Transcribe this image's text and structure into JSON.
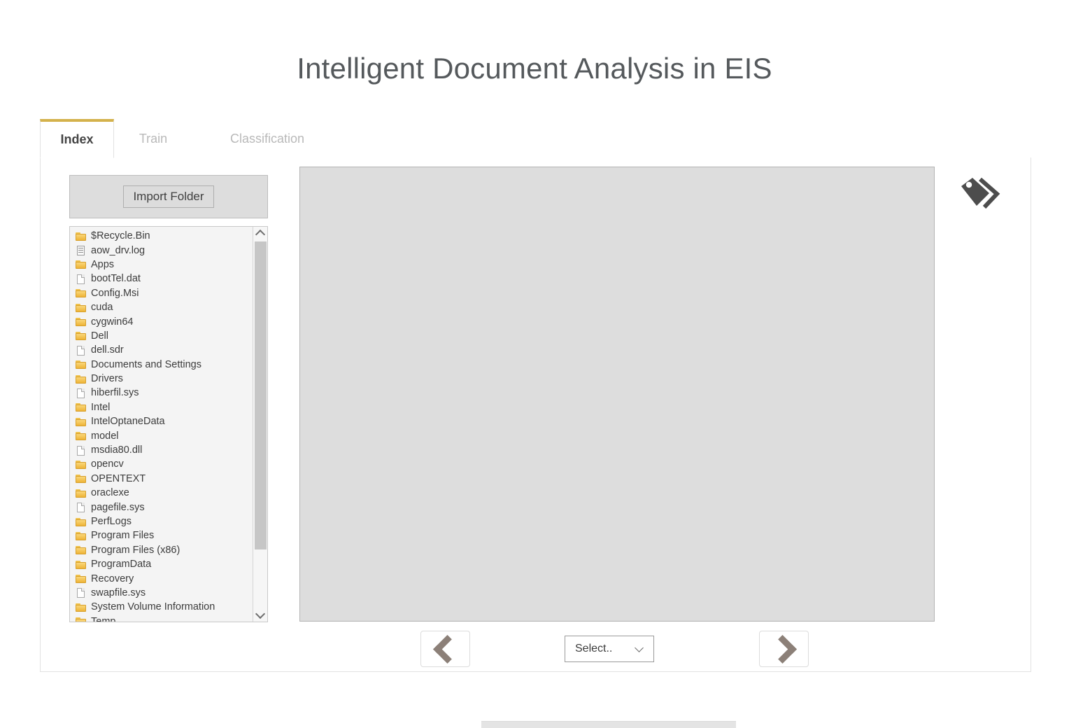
{
  "page": {
    "title": "Intelligent Document Analysis in EIS",
    "accent_color": "#d4b24c",
    "active_tab_text_color": "#444444",
    "inactive_tab_text_color": "#b9b9b9",
    "title_color": "#55595c",
    "preview_bg_color": "#dddddd",
    "nav_arrow_color": "#8c8078",
    "folder_icon_color": "#eeb437"
  },
  "tabs": [
    {
      "label": "Index",
      "active": true
    },
    {
      "label": "Train",
      "active": false
    },
    {
      "label": "Classification",
      "active": false
    }
  ],
  "left_panel": {
    "import_button_label": "Import Folder"
  },
  "file_list": {
    "items": [
      {
        "name": "$Recycle.Bin",
        "type": "folder"
      },
      {
        "name": "aow_drv.log",
        "type": "document"
      },
      {
        "name": "Apps",
        "type": "folder"
      },
      {
        "name": "bootTel.dat",
        "type": "file"
      },
      {
        "name": "Config.Msi",
        "type": "folder"
      },
      {
        "name": "cuda",
        "type": "folder"
      },
      {
        "name": "cygwin64",
        "type": "folder"
      },
      {
        "name": "Dell",
        "type": "folder"
      },
      {
        "name": "dell.sdr",
        "type": "file"
      },
      {
        "name": "Documents and Settings",
        "type": "folder"
      },
      {
        "name": "Drivers",
        "type": "folder"
      },
      {
        "name": "hiberfil.sys",
        "type": "file"
      },
      {
        "name": "Intel",
        "type": "folder"
      },
      {
        "name": "IntelOptaneData",
        "type": "folder"
      },
      {
        "name": "model",
        "type": "folder"
      },
      {
        "name": "msdia80.dll",
        "type": "file"
      },
      {
        "name": "opencv",
        "type": "folder"
      },
      {
        "name": "OPENTEXT",
        "type": "folder"
      },
      {
        "name": "oraclexe",
        "type": "folder"
      },
      {
        "name": "pagefile.sys",
        "type": "file"
      },
      {
        "name": "PerfLogs",
        "type": "folder"
      },
      {
        "name": "Program Files",
        "type": "folder"
      },
      {
        "name": "Program Files (x86)",
        "type": "folder"
      },
      {
        "name": "ProgramData",
        "type": "folder"
      },
      {
        "name": "Recovery",
        "type": "folder"
      },
      {
        "name": "swapfile.sys",
        "type": "file"
      },
      {
        "name": "System Volume Information",
        "type": "folder"
      },
      {
        "name": "Temp",
        "type": "folder"
      }
    ]
  },
  "controls": {
    "prev_icon": "chevron-left-icon",
    "next_icon": "chevron-right-icon",
    "select_value": "Select..",
    "select_options": [
      "Select.."
    ]
  },
  "icons": {
    "tag": "tags-icon"
  }
}
